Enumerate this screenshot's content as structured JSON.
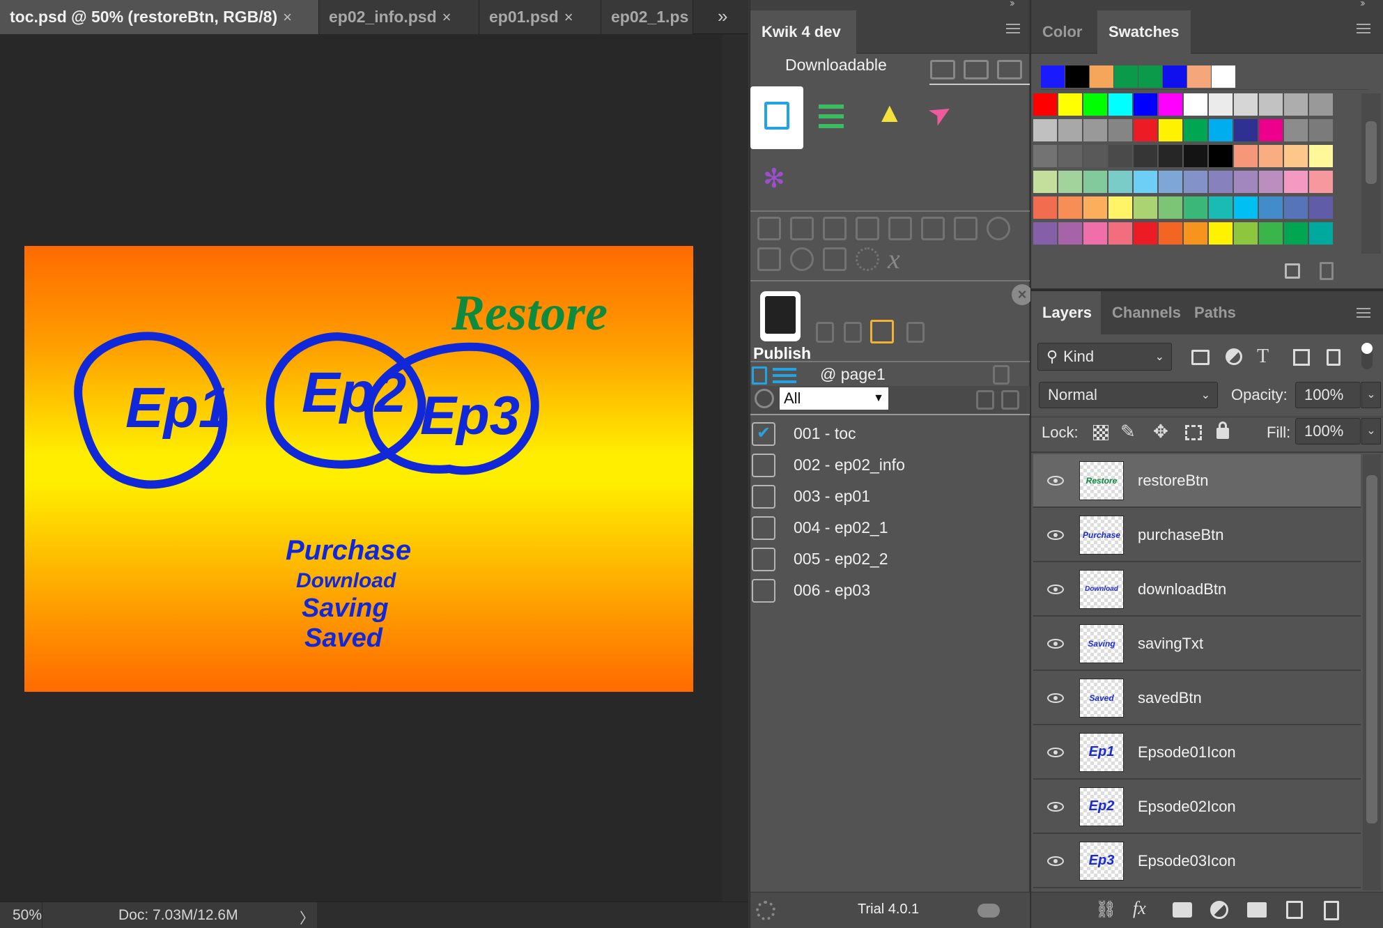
{
  "document_tabs": [
    {
      "label": "toc.psd @ 50% (restoreBtn, RGB/8)",
      "close": "×",
      "active": true
    },
    {
      "label": "ep02_info.psd",
      "close": "×",
      "active": false
    },
    {
      "label": "ep01.psd",
      "close": "×",
      "active": false
    },
    {
      "label": "ep02_1.ps",
      "close": "",
      "active": false
    }
  ],
  "tab_overflow": "»",
  "canvas": {
    "restore_text": "Restore",
    "episodes": [
      "Ep1",
      "Ep2",
      "Ep3"
    ],
    "button_texts": [
      "Purchase",
      "Download",
      "Saving",
      "Saved"
    ],
    "colors": {
      "blue": "#1028d8",
      "green": "#0e8a3e",
      "orange": "#ff6a00",
      "yellow": "#ffee00"
    }
  },
  "status": {
    "zoom": "50%",
    "doc": "Doc: 7.03M/12.6M",
    "arrow": "〉"
  },
  "kwik": {
    "tab_label": "Kwik 4 dev",
    "downloadable_label": "Downloadable",
    "publish_label": "Publish",
    "page_label": "@ page1",
    "filter_value": "All",
    "pages": [
      {
        "label": "001 - toc",
        "checked": true
      },
      {
        "label": "002 - ep02_info",
        "checked": false
      },
      {
        "label": "003 - ep01",
        "checked": false
      },
      {
        "label": "004 - ep02_1",
        "checked": false
      },
      {
        "label": "005 - ep02_2",
        "checked": false
      },
      {
        "label": "006 - ep03",
        "checked": false
      }
    ],
    "trial_label": "Trial 4.0.1"
  },
  "color_panel": {
    "tabs": [
      "Color",
      "Swatches"
    ],
    "active_tab": "Swatches",
    "recent": [
      "#1a1aff",
      "#000000",
      "#f5a65b",
      "#0a9a4a",
      "#0a9a4a",
      "#1010ee",
      "#f5a67a",
      "#ffffff"
    ],
    "grid_rows": [
      [
        "#ff0000",
        "#ffff00",
        "#00ff00",
        "#00ffff",
        "#0000ff",
        "#ff00ff",
        "#ffffff",
        "#ebebeb",
        "#d6d6d6",
        "#c2c2c2",
        "#adadad",
        "#999999"
      ],
      [
        "#c0c0c0",
        "#a8a8a8",
        "#999999",
        "#858585",
        "#ed1c24",
        "#fff200",
        "#00a651",
        "#00aeef",
        "#2e3192",
        "#ec008c",
        "#8c8c8c",
        "#7b7b7b"
      ],
      [
        "#737373",
        "#636363",
        "#595959",
        "#4a4a4a",
        "#363636",
        "#262626",
        "#141414",
        "#000000",
        "#f7977a",
        "#f9ad81",
        "#fdc68a",
        "#fff799"
      ],
      [
        "#c4df9b",
        "#a3d39c",
        "#82ca9c",
        "#7accc8",
        "#6dcff6",
        "#7ea7d8",
        "#8393ca",
        "#8781bd",
        "#a187be",
        "#bc8dbf",
        "#f49ac2",
        "#f6989d"
      ],
      [
        "#f26c4f",
        "#f68e55",
        "#fbaf5c",
        "#fff467",
        "#acd372",
        "#7cc576",
        "#3bb878",
        "#1abbb4",
        "#00bff3",
        "#438ccb",
        "#5574b9",
        "#605ca8"
      ],
      [
        "#8560a8",
        "#a763a8",
        "#f06eaa",
        "#f26d7d",
        "#ed1c24",
        "#f26522",
        "#f7941d",
        "#fff200",
        "#8dc63f",
        "#39b54a",
        "#00a651",
        "#00a99d"
      ]
    ]
  },
  "layers_panel": {
    "tabs": [
      "Layers",
      "Channels",
      "Paths"
    ],
    "active_tab": "Layers",
    "kind_label": "Kind",
    "blend_mode": "Normal",
    "opacity_label": "Opacity:",
    "opacity_value": "100%",
    "lock_label": "Lock:",
    "fill_label": "Fill:",
    "fill_value": "100%",
    "layers": [
      {
        "name": "restoreBtn",
        "thumb": "Restore",
        "selected": true
      },
      {
        "name": "purchaseBtn",
        "thumb": "Purchase",
        "selected": false
      },
      {
        "name": "downloadBtn",
        "thumb": "Download",
        "selected": false
      },
      {
        "name": "savingTxt",
        "thumb": "Saving",
        "selected": false
      },
      {
        "name": "savedBtn",
        "thumb": "Saved",
        "selected": false
      },
      {
        "name": "Epsode01Icon",
        "thumb": "Ep1",
        "selected": false
      },
      {
        "name": "Epsode02Icon",
        "thumb": "Ep2",
        "selected": false
      },
      {
        "name": "Epsode03Icon",
        "thumb": "Ep3",
        "selected": false
      }
    ],
    "footer_icons": [
      "link-icon",
      "fx-icon",
      "mask-icon",
      "adjustment-icon",
      "folder-icon",
      "new-layer-icon",
      "trash-icon"
    ]
  }
}
